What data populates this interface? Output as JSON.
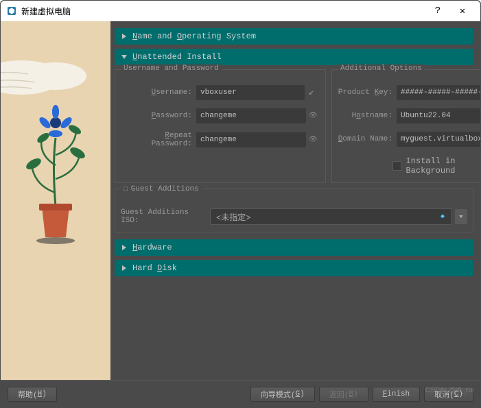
{
  "window": {
    "title": "新建虚拟电脑"
  },
  "sections": {
    "name_os": "Name and Operating System",
    "unattended": "Unattended Install",
    "hardware": "Hardware",
    "hard_disk": "Hard Disk"
  },
  "user_group": {
    "title": "Username and Password",
    "username_label": "Username:",
    "username": "vboxuser",
    "password_label": "Password:",
    "password": "changeme",
    "repeat_label": "Repeat Password:",
    "repeat": "changeme"
  },
  "options_group": {
    "title": "Additional Options",
    "product_key_label": "Product Key:",
    "product_key": "#####-#####-#####-#####-#####",
    "hostname_label": "Hostname:",
    "hostname": "Ubuntu22.04",
    "domain_label": "Domain Name:",
    "domain": "myguest.virtualbox.org",
    "bg_install": "Install in Background"
  },
  "ga_group": {
    "title": "Guest Additions",
    "iso_label": "Guest Additions ISO:",
    "iso_value": "<未指定>"
  },
  "footer": {
    "help": "帮助(H)",
    "expert": "向导模式(G)",
    "back": "返回(B)",
    "finish": "Finish",
    "cancel": "取消(C)"
  },
  "watermark": "CSDN @ifi_rui"
}
